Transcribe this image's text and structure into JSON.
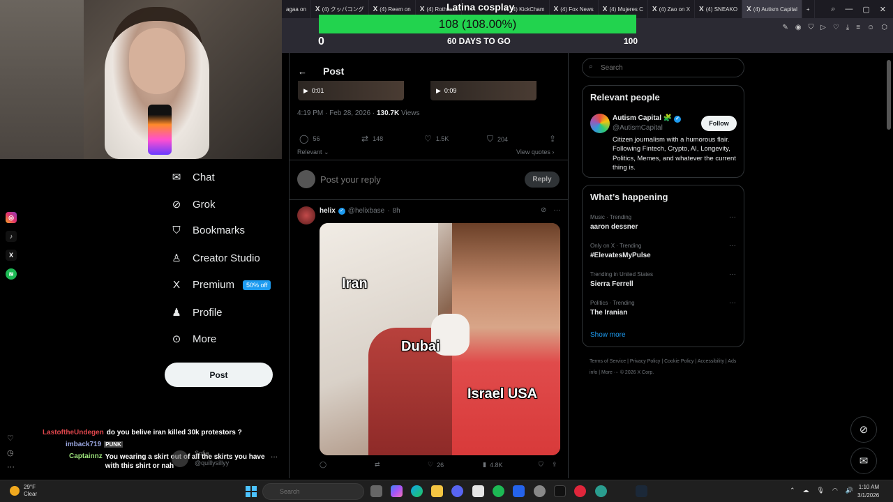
{
  "browser": {
    "tabs": [
      {
        "label": "agaa on"
      },
      {
        "label": "(4) クッパコング"
      },
      {
        "label": "(4) Reem on"
      },
      {
        "label": "(4) Rothmus"
      },
      {
        "label": "(4) KickCham"
      },
      {
        "label": "(4) Fox News"
      },
      {
        "label": "(4) Mujeres C"
      },
      {
        "label": "(4) Zao on X"
      },
      {
        "label": "(4) SNEAKO"
      },
      {
        "label": "(4) Autism Capital"
      }
    ]
  },
  "overlay": {
    "title": "Latina cosplay",
    "goal_text": "108 (108.00%)",
    "goal_progress": 1.0,
    "goal_min": "0",
    "goal_days": "60 DAYS TO GO",
    "goal_max": "100"
  },
  "nav": {
    "items": [
      {
        "label": "Chat",
        "icon": "chat-icon"
      },
      {
        "label": "Grok",
        "icon": "grok-icon"
      },
      {
        "label": "Bookmarks",
        "icon": "bookmark-icon"
      },
      {
        "label": "Creator Studio",
        "icon": "creator-studio-icon"
      },
      {
        "label": "Premium",
        "icon": "x-logo-icon"
      },
      {
        "label": "Profile",
        "icon": "profile-icon"
      },
      {
        "label": "More",
        "icon": "more-icon"
      }
    ],
    "premium_badge": "50% off",
    "post_button": "Post"
  },
  "chat": [
    {
      "user": "LastoftheUndegen",
      "text": "do you belive iran killed 30k protestors ?",
      "color": "#e0464c"
    },
    {
      "user": "imback719",
      "text": "",
      "color": "#9aa6e0"
    },
    {
      "user": "Captainnz",
      "text": "You wearing a skirt out of all the skirts you have with this shirt or nah",
      "color": "#9be07a"
    }
  ],
  "account_preview": {
    "name": "Sofia",
    "handle": "@quillysillyy"
  },
  "main": {
    "header_title": "Post",
    "video1_time": "0:01",
    "video2_time": "0:09",
    "post_time": "4:19 PM · Feb 28, 2026 · ",
    "views_count": "130.7K",
    "views_label": " Views",
    "stats": {
      "replies": "56",
      "reposts": "148",
      "likes": "1.5K",
      "bookmarks": "204"
    },
    "relevant": "Relevant",
    "view_quotes": "View quotes",
    "reply_placeholder": "Post your reply",
    "reply_button": "Reply",
    "tweet2": {
      "name": "helix",
      "handle": "@helixbase",
      "time": "8h",
      "meme_labels": {
        "a": "Iran",
        "b": "Dubai",
        "c": "Israel USA"
      },
      "stats": {
        "likes": "26",
        "views": "4.8K"
      }
    }
  },
  "sidebar": {
    "search_placeholder": "Search",
    "relevant_title": "Relevant people",
    "person": {
      "name": "Autism Capital 🧩",
      "handle": "@AutismCapital",
      "follow": "Follow",
      "bio": "Citizen journalism with a humorous flair. Following Fintech, Crypto, AI, Longevity, Politics, Memes, and whatever the current thing is."
    },
    "happening_title": "What’s happening",
    "trends": [
      {
        "context": "Music · Trending",
        "name": "aaron dessner"
      },
      {
        "context": "Only on X · Trending",
        "name": "#ElevatesMyPulse"
      },
      {
        "context": "Trending in United States",
        "name": "Sierra Ferrell"
      },
      {
        "context": "Politics · Trending",
        "name": "The Iranian"
      }
    ],
    "show_more": "Show more",
    "footer": "Terms of Service  |  Privacy Policy  |  Cookie Policy  |  Accessibility  |  Ads info  |  More ···  © 2026 X Corp."
  },
  "taskbar": {
    "weather_temp": "29°F",
    "weather_desc": "Clear",
    "search": "Search",
    "time": "1:10 AM",
    "date": "3/1/2026"
  }
}
